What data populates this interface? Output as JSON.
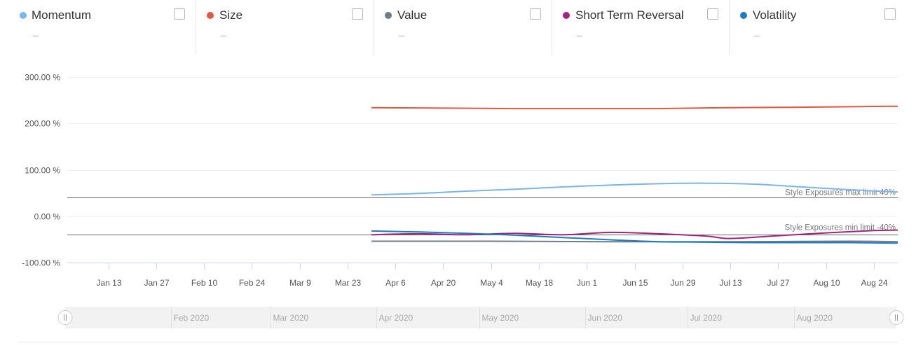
{
  "legend": {
    "items": [
      {
        "name": "Momentum",
        "value": "–",
        "color": "#7cb5ec"
      },
      {
        "name": "Size",
        "value": "–",
        "color": "#e4563f"
      },
      {
        "name": "Value",
        "value": "–",
        "color": "#707b88"
      },
      {
        "name": "Short Term Reversal",
        "value": "–",
        "color": "#a3247d"
      },
      {
        "name": "Volatility",
        "value": "–",
        "color": "#1f7cc4"
      }
    ]
  },
  "chart_data": {
    "type": "line",
    "xaxis_type": "date",
    "y_tick_labels": [
      "300.00 %",
      "200.00 %",
      "100.00 %",
      "0.00 %",
      "-100.00 %"
    ],
    "y_ticks": [
      300,
      200,
      100,
      0,
      -100
    ],
    "ylim": [
      -100,
      300
    ],
    "xlim": [
      "2020-01-01",
      "2020-08-31"
    ],
    "x_ticks": [
      "2020-01-13",
      "2020-01-27",
      "2020-02-10",
      "2020-02-24",
      "2020-03-09",
      "2020-03-23",
      "2020-04-06",
      "2020-04-20",
      "2020-05-04",
      "2020-05-18",
      "2020-06-01",
      "2020-06-15",
      "2020-06-29",
      "2020-07-13",
      "2020-07-27",
      "2020-08-10",
      "2020-08-24"
    ],
    "x_tick_labels": [
      "Jan 13",
      "Jan 27",
      "Feb 10",
      "Feb 24",
      "Mar 9",
      "Mar 23",
      "Apr 6",
      "Apr 20",
      "May 4",
      "May 18",
      "Jun 1",
      "Jun 15",
      "Jun 29",
      "Jul 13",
      "Jul 27",
      "Aug 10",
      "Aug 24"
    ],
    "plot_lines": [
      {
        "label": "Style Exposures max limit 40%",
        "value": 40,
        "color": "#666666"
      },
      {
        "label": "Style Exposures min limit -40%",
        "value": -40,
        "color": "#666666"
      }
    ],
    "series": [
      {
        "name": "Momentum",
        "color": "#7cb5ec",
        "x": [
          "2020-03-30",
          "2020-04-13",
          "2020-04-27",
          "2020-05-11",
          "2020-05-25",
          "2020-06-08",
          "2020-06-22",
          "2020-07-06",
          "2020-07-20",
          "2020-08-03",
          "2020-08-17",
          "2020-08-31"
        ],
        "y": [
          46,
          49,
          54,
          58,
          63,
          67,
          70,
          71,
          69,
          63,
          57,
          52
        ]
      },
      {
        "name": "Size",
        "color": "#e4563f",
        "x": [
          "2020-03-30",
          "2020-04-20",
          "2020-05-11",
          "2020-06-01",
          "2020-06-22",
          "2020-07-13",
          "2020-08-03",
          "2020-08-31"
        ],
        "y": [
          234,
          233,
          232,
          232,
          232,
          234,
          235,
          237
        ]
      },
      {
        "name": "Value",
        "color": "#707b88",
        "x": [
          "2020-03-30",
          "2020-05-04",
          "2020-06-08",
          "2020-07-13",
          "2020-08-17",
          "2020-08-31"
        ],
        "y": [
          -54,
          -54,
          -55,
          -55,
          -54,
          -55
        ]
      },
      {
        "name": "Short Term Reversal",
        "color": "#a3247d",
        "x": [
          "2020-03-30",
          "2020-04-13",
          "2020-04-27",
          "2020-05-11",
          "2020-05-25",
          "2020-06-08",
          "2020-06-22",
          "2020-07-06",
          "2020-07-13",
          "2020-07-27",
          "2020-08-10",
          "2020-08-24",
          "2020-08-31"
        ],
        "y": [
          -40,
          -38,
          -40,
          -37,
          -40,
          -35,
          -38,
          -43,
          -48,
          -42,
          -36,
          -31,
          -30
        ]
      },
      {
        "name": "Volatility",
        "color": "#1f7cc4",
        "x": [
          "2020-03-30",
          "2020-04-13",
          "2020-04-27",
          "2020-05-11",
          "2020-05-25",
          "2020-06-08",
          "2020-06-22",
          "2020-07-06",
          "2020-07-20",
          "2020-08-03",
          "2020-08-17",
          "2020-08-31"
        ],
        "y": [
          -32,
          -34,
          -37,
          -41,
          -46,
          -51,
          -55,
          -56,
          -57,
          -57,
          -57,
          -58
        ]
      }
    ],
    "navigator": {
      "labels": [
        "Feb 2020",
        "Mar 2020",
        "Apr 2020",
        "May 2020",
        "Jun 2020",
        "Jul 2020",
        "Aug 2020"
      ],
      "dates": [
        "2020-02-01",
        "2020-03-01",
        "2020-04-01",
        "2020-05-01",
        "2020-06-01",
        "2020-07-01",
        "2020-08-01"
      ]
    }
  }
}
